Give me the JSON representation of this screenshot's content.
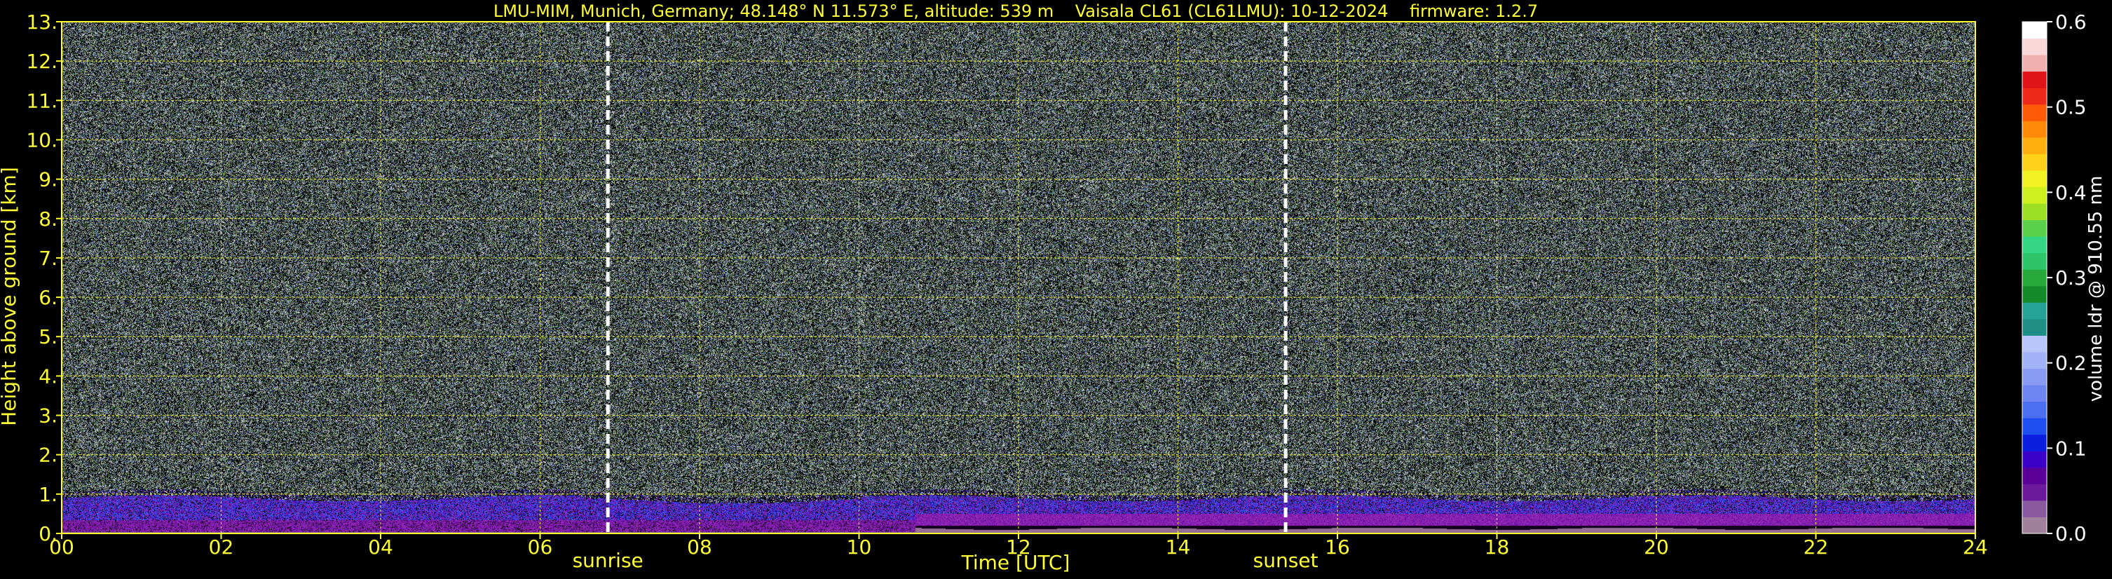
{
  "chart_data": {
    "type": "heatmap",
    "title": "LMU-MIM, Munich, Germany; 48.148° N 11.573° E, altitude: 539 m    Vaisala CL61 (CL61LMU): 10-12-2024    firmware: 1.2.7",
    "xlabel": "Time [UTC]",
    "ylabel": "Height above ground [km]",
    "xlim": [
      0,
      24
    ],
    "ylim": [
      0,
      13
    ],
    "x_ticks": [
      {
        "value": 0,
        "label": "00"
      },
      {
        "value": 2,
        "label": "02"
      },
      {
        "value": 4,
        "label": "04"
      },
      {
        "value": 6,
        "label": "06"
      },
      {
        "value": 8,
        "label": "08"
      },
      {
        "value": 10,
        "label": "10"
      },
      {
        "value": 12,
        "label": "12"
      },
      {
        "value": 14,
        "label": "14"
      },
      {
        "value": 16,
        "label": "16"
      },
      {
        "value": 18,
        "label": "18"
      },
      {
        "value": 20,
        "label": "20"
      },
      {
        "value": 22,
        "label": "22"
      },
      {
        "value": 24,
        "label": "24"
      }
    ],
    "y_ticks": [
      {
        "value": 0,
        "label": "0."
      },
      {
        "value": 1,
        "label": "1."
      },
      {
        "value": 2,
        "label": "2."
      },
      {
        "value": 3,
        "label": "3."
      },
      {
        "value": 4,
        "label": "4."
      },
      {
        "value": 5,
        "label": "5."
      },
      {
        "value": 6,
        "label": "6."
      },
      {
        "value": 7,
        "label": "7."
      },
      {
        "value": 8,
        "label": "8."
      },
      {
        "value": 9,
        "label": "9."
      },
      {
        "value": 10,
        "label": "10."
      },
      {
        "value": 11,
        "label": "11."
      },
      {
        "value": 12,
        "label": "12."
      },
      {
        "value": 13,
        "label": "13."
      }
    ],
    "grid": true,
    "annotations": [
      {
        "label": "sunrise",
        "x": 6.85
      },
      {
        "label": "sunset",
        "x": 15.35
      }
    ],
    "colorbar": {
      "label": "volume ldr @ 910.55 nm",
      "range": [
        0.0,
        0.6
      ],
      "ticks": [
        {
          "value": 0.0,
          "label": "0.0"
        },
        {
          "value": 0.1,
          "label": "0.1"
        },
        {
          "value": 0.2,
          "label": "0.2"
        },
        {
          "value": 0.3,
          "label": "0.3"
        },
        {
          "value": 0.4,
          "label": "0.4"
        },
        {
          "value": 0.5,
          "label": "0.5"
        },
        {
          "value": 0.6,
          "label": "0.6"
        }
      ],
      "colors": [
        "#a0809a",
        "#8a5aa0",
        "#6a1a9a",
        "#5a0098",
        "#3a00c8",
        "#0a1ee0",
        "#1f4ef0",
        "#4c6ef0",
        "#6f86f2",
        "#8a9cf2",
        "#a2b2f6",
        "#b8c6fa",
        "#1f8f86",
        "#27a296",
        "#158a2a",
        "#27a83a",
        "#2ec46a",
        "#34d684",
        "#5bd04a",
        "#9cdf24",
        "#cdf01e",
        "#f0f222",
        "#ffd21a",
        "#ffb010",
        "#ff8a0a",
        "#ff5a08",
        "#f02a1a",
        "#e01418",
        "#f0b0b0",
        "#f8d8d8",
        "#ffffff"
      ]
    },
    "layers": [
      {
        "name": "noise",
        "x_range": [
          0,
          24
        ],
        "height_range_km": [
          1.0,
          13.0
        ],
        "value_range": [
          0.0,
          0.6
        ]
      },
      {
        "name": "boundary_layer",
        "x_range": [
          0,
          24
        ],
        "height_range_km": [
          0.15,
          0.95
        ],
        "value_range": [
          0.0,
          0.12
        ]
      },
      {
        "name": "dense_layer",
        "x_range": [
          10.7,
          24
        ],
        "height_range_km": [
          0.05,
          0.5
        ],
        "value_range": [
          0.0,
          0.08
        ]
      }
    ]
  }
}
